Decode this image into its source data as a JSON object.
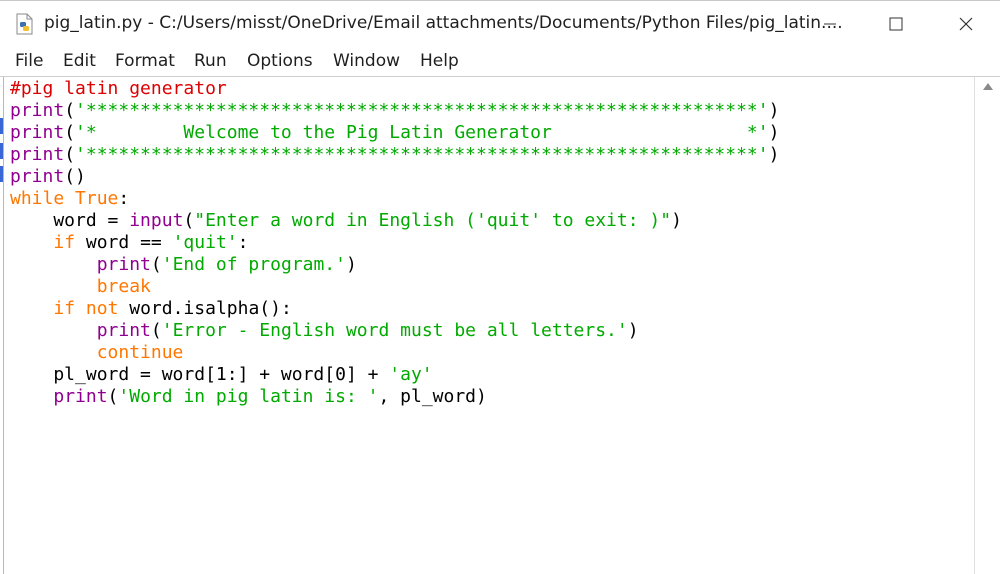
{
  "window": {
    "title": "pig_latin.py - C:/Users/misst/OneDrive/Email attachments/Documents/Python Files/pig_latin....",
    "minimize_icon": "minimize-icon",
    "maximize_icon": "maximize-icon",
    "close_icon": "close-icon"
  },
  "menu": [
    {
      "label": "File"
    },
    {
      "label": "Edit"
    },
    {
      "label": "Format"
    },
    {
      "label": "Run"
    },
    {
      "label": "Options"
    },
    {
      "label": "Window"
    },
    {
      "label": "Help"
    }
  ],
  "colors": {
    "keyword": "#ff7700",
    "builtin": "#900090",
    "string": "#00aa00",
    "comment": "#dd0000"
  },
  "code_lines": [
    [
      {
        "t": "com",
        "v": "#pig latin generator"
      }
    ],
    [
      {
        "t": "bi",
        "v": "print"
      },
      {
        "t": "",
        "v": "("
      },
      {
        "t": "str",
        "v": "'**************************************************************'"
      },
      {
        "t": "",
        "v": ")"
      }
    ],
    [
      {
        "t": "bi",
        "v": "print"
      },
      {
        "t": "",
        "v": "("
      },
      {
        "t": "str",
        "v": "'*        Welcome to the Pig Latin Generator                  *'"
      },
      {
        "t": "",
        "v": ")"
      }
    ],
    [
      {
        "t": "bi",
        "v": "print"
      },
      {
        "t": "",
        "v": "("
      },
      {
        "t": "str",
        "v": "'**************************************************************'"
      },
      {
        "t": "",
        "v": ")"
      }
    ],
    [
      {
        "t": "bi",
        "v": "print"
      },
      {
        "t": "",
        "v": "()"
      }
    ],
    [
      {
        "t": "kw",
        "v": "while"
      },
      {
        "t": "",
        "v": " "
      },
      {
        "t": "kw",
        "v": "True"
      },
      {
        "t": "",
        "v": ":"
      }
    ],
    [
      {
        "t": "",
        "v": "    word = "
      },
      {
        "t": "bi",
        "v": "input"
      },
      {
        "t": "",
        "v": "("
      },
      {
        "t": "str",
        "v": "\"Enter a word in English ('quit' to exit: )\""
      },
      {
        "t": "",
        "v": ")"
      }
    ],
    [
      {
        "t": "",
        "v": "    "
      },
      {
        "t": "kw",
        "v": "if"
      },
      {
        "t": "",
        "v": " word == "
      },
      {
        "t": "str",
        "v": "'quit'"
      },
      {
        "t": "",
        "v": ":"
      }
    ],
    [
      {
        "t": "",
        "v": "        "
      },
      {
        "t": "bi",
        "v": "print"
      },
      {
        "t": "",
        "v": "("
      },
      {
        "t": "str",
        "v": "'End of program.'"
      },
      {
        "t": "",
        "v": ")"
      }
    ],
    [
      {
        "t": "",
        "v": "        "
      },
      {
        "t": "kw",
        "v": "break"
      }
    ],
    [
      {
        "t": "",
        "v": "    "
      },
      {
        "t": "kw",
        "v": "if"
      },
      {
        "t": "",
        "v": " "
      },
      {
        "t": "kw",
        "v": "not"
      },
      {
        "t": "",
        "v": " word.isalpha():"
      }
    ],
    [
      {
        "t": "",
        "v": "        "
      },
      {
        "t": "bi",
        "v": "print"
      },
      {
        "t": "",
        "v": "("
      },
      {
        "t": "str",
        "v": "'Error - English word must be all letters.'"
      },
      {
        "t": "",
        "v": ")"
      }
    ],
    [
      {
        "t": "",
        "v": "        "
      },
      {
        "t": "kw",
        "v": "continue"
      }
    ],
    [
      {
        "t": "",
        "v": "    pl_word = word[1:] + word[0] + "
      },
      {
        "t": "str",
        "v": "'ay'"
      }
    ],
    [
      {
        "t": "",
        "v": "    "
      },
      {
        "t": "bi",
        "v": "print"
      },
      {
        "t": "",
        "v": "("
      },
      {
        "t": "str",
        "v": "'Word in pig latin is: '"
      },
      {
        "t": "",
        "v": ", pl_word)"
      }
    ]
  ]
}
